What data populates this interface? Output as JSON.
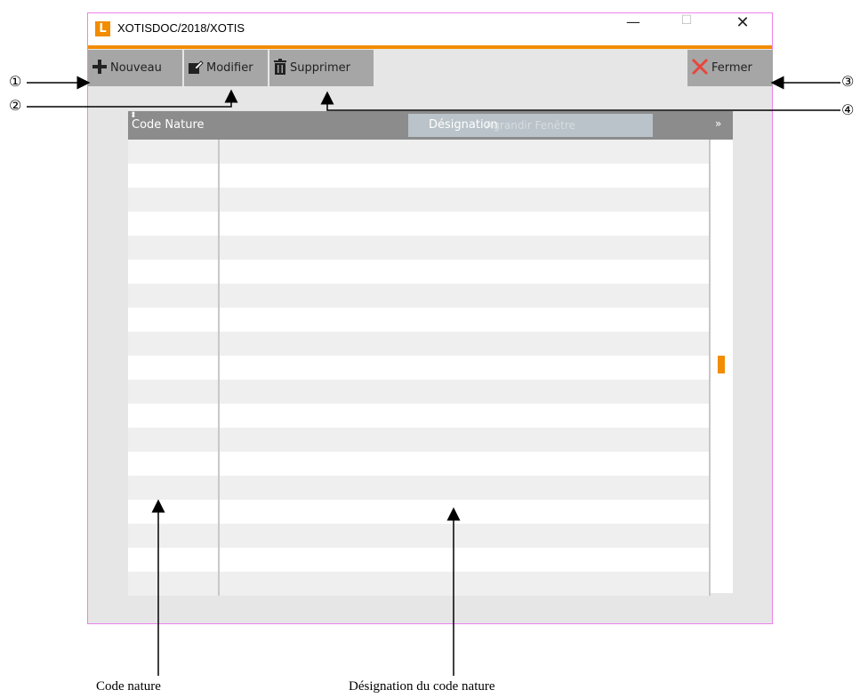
{
  "window": {
    "title": "XOTISDOC/2018/XOTIS",
    "logo_letter": "L",
    "controls": {
      "minimize": "—",
      "maximize": "☐",
      "close": "✕"
    }
  },
  "toolbar": {
    "new_label": "Nouveau",
    "modify_label": "Modifier",
    "delete_label": "Supprimer",
    "close_label": "Fermer",
    "icons": {
      "new": "plus-icon",
      "modify": "edit-icon",
      "delete": "trash-icon",
      "close": "close-x-icon"
    }
  },
  "grid": {
    "ghost_text": "Agrandir Fenêtre",
    "columns": [
      "Code Nature",
      "Désignation"
    ],
    "rows": [
      [
        "",
        ""
      ],
      [
        "",
        ""
      ],
      [
        "",
        ""
      ],
      [
        "",
        ""
      ],
      [
        "",
        ""
      ],
      [
        "",
        ""
      ],
      [
        "",
        ""
      ],
      [
        "",
        ""
      ],
      [
        "",
        ""
      ],
      [
        "",
        ""
      ],
      [
        "",
        ""
      ],
      [
        "",
        ""
      ],
      [
        "",
        ""
      ],
      [
        "",
        ""
      ],
      [
        "",
        ""
      ],
      [
        "",
        ""
      ],
      [
        "",
        ""
      ],
      [
        "",
        ""
      ],
      [
        "",
        ""
      ]
    ]
  },
  "annotations": {
    "callouts": [
      "①",
      "②",
      "③",
      "④"
    ],
    "code_nature": "Code nature",
    "designation": "Désignation du code nature"
  },
  "colors": {
    "accent": "#f28c00",
    "button_bg": "#a6a6a6",
    "header_bg": "#8c8c8c",
    "close_red": "#e8453c"
  }
}
